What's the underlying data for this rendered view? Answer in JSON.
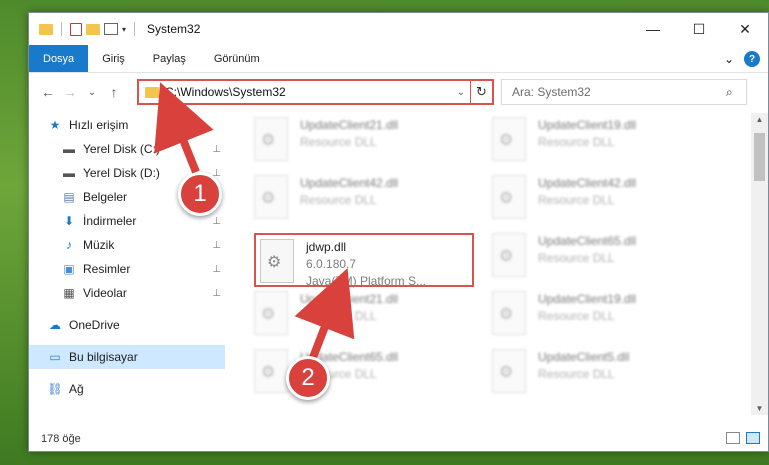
{
  "window": {
    "title": "System32",
    "controls": {
      "minimize": "—",
      "maximize": "☐",
      "close": "✕"
    }
  },
  "ribbon": {
    "tabs": [
      "Dosya",
      "Giriş",
      "Paylaş",
      "Görünüm"
    ],
    "collapse": "⌄",
    "help": "?"
  },
  "nav": {
    "back": "←",
    "forward": "→",
    "recent": "⌄",
    "up": "↑",
    "address": "C:\\Windows\\System32",
    "dropdown": "⌄",
    "refresh": "↻",
    "search_placeholder": "Ara: System32",
    "search_icon": "⌕"
  },
  "sidebar": {
    "items": [
      {
        "label": "Hızlı erişim",
        "icon": "star-icon",
        "glyph": "★",
        "color": "#1979ca",
        "pinned": false
      },
      {
        "label": "Yerel Disk (C:)",
        "icon": "drive-icon",
        "glyph": "▬",
        "color": "#555",
        "pinned": true
      },
      {
        "label": "Yerel Disk (D:)",
        "icon": "drive-icon",
        "glyph": "▬",
        "color": "#555",
        "pinned": true
      },
      {
        "label": "Belgeler",
        "icon": "documents-icon",
        "glyph": "▤",
        "color": "#5a7fa8",
        "pinned": true
      },
      {
        "label": "İndirmeler",
        "icon": "download-icon",
        "glyph": "⬇",
        "color": "#1979ca",
        "pinned": true
      },
      {
        "label": "Müzik",
        "icon": "music-icon",
        "glyph": "♪",
        "color": "#1979ca",
        "pinned": true
      },
      {
        "label": "Resimler",
        "icon": "pictures-icon",
        "glyph": "▣",
        "color": "#4a8fcf",
        "pinned": true
      },
      {
        "label": "Videolar",
        "icon": "video-icon",
        "glyph": "▦",
        "color": "#555",
        "pinned": true
      },
      {
        "label": "OneDrive",
        "icon": "onedrive-icon",
        "glyph": "☁",
        "color": "#1979ca",
        "pinned": false
      },
      {
        "label": "Bu bilgisayar",
        "icon": "computer-icon",
        "glyph": "▭",
        "color": "#2f7bc7",
        "pinned": false
      },
      {
        "label": "Ağ",
        "icon": "network-icon",
        "glyph": "⛓",
        "color": "#2f7bc7",
        "pinned": false
      }
    ],
    "pin_glyph": "📌"
  },
  "files": [
    {
      "name": "UpdateClient21.dll",
      "sub": "Resource DLL",
      "blur": true
    },
    {
      "name": "UpdateClient19.dll",
      "sub": "Resource DLL",
      "blur": true
    },
    {
      "name": "UpdateClient42.dll",
      "sub": "Resource DLL",
      "blur": true
    },
    {
      "name": "UpdateClient42.dll",
      "sub": "Resource DLL",
      "blur": true
    },
    {
      "name": "jdwp.dll",
      "sub": "6.0.180.7",
      "sub2": "Java(TM) Platform S...",
      "blur": false,
      "highlight": true
    },
    {
      "name": "UpdateClient65.dll",
      "sub": "Resource DLL",
      "blur": true
    },
    {
      "name": "UpdateClient21.dll",
      "sub": "Resource DLL",
      "blur": true
    },
    {
      "name": "UpdateClient19.dll",
      "sub": "Resource DLL",
      "blur": true
    },
    {
      "name": "UpdateClient65.dll",
      "sub": "Resource DLL",
      "blur": true
    },
    {
      "name": "UpdateClient5.dll",
      "sub": "Resource DLL",
      "blur": true
    }
  ],
  "status": {
    "count": "178 öğe"
  },
  "annotations": {
    "step1": "1",
    "step2": "2",
    "color": "#d9413c"
  },
  "scroll": {
    "up": "▲",
    "down": "▼"
  }
}
